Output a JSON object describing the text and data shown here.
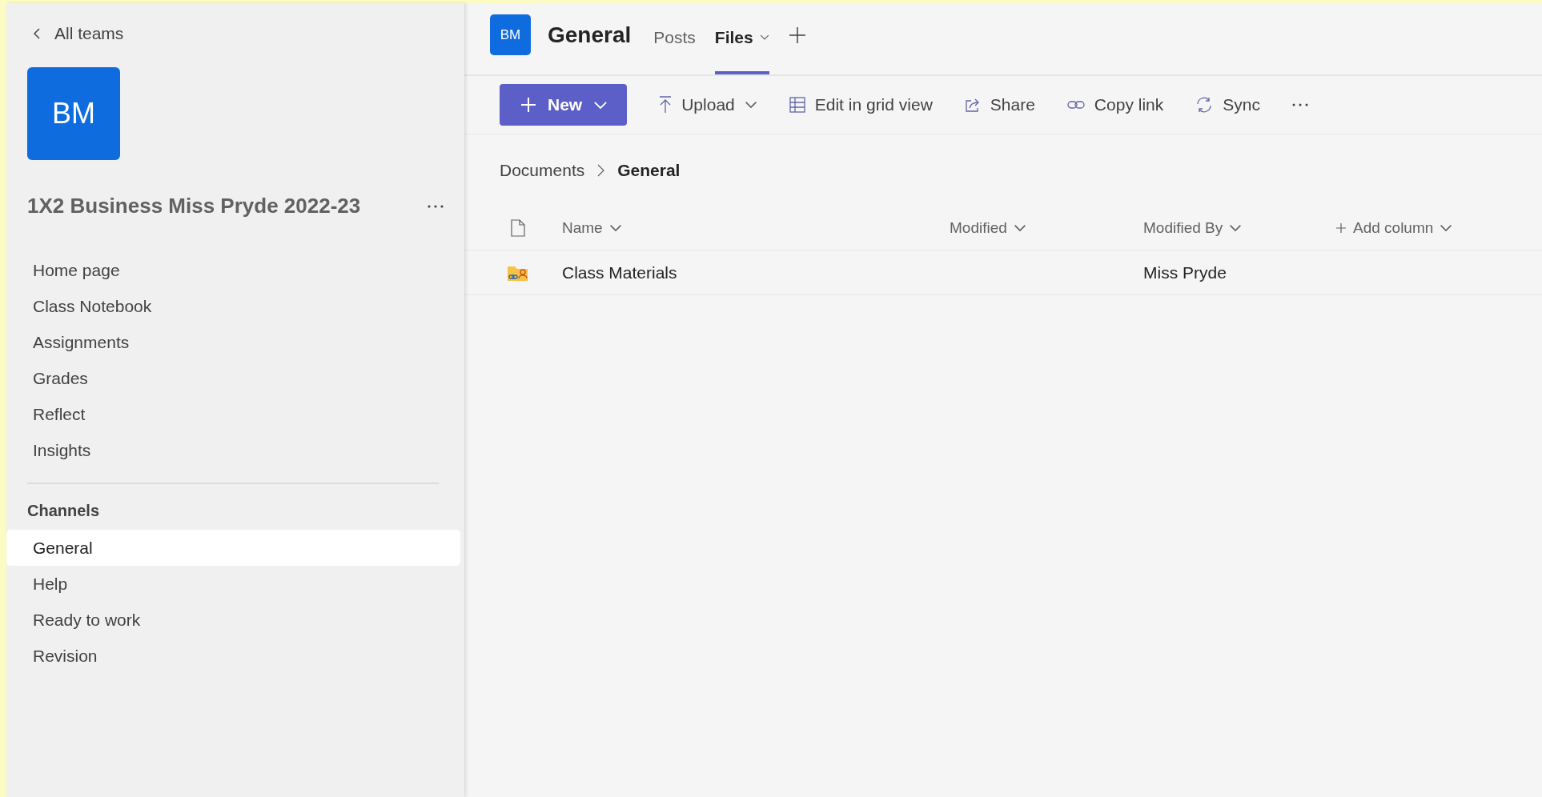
{
  "sidebar": {
    "back_link": "All teams",
    "team_avatar": "BM",
    "team_name": "1X2 Business Miss Pryde 2022-23",
    "nav_items": [
      {
        "label": "Home page"
      },
      {
        "label": "Class Notebook"
      },
      {
        "label": "Assignments"
      },
      {
        "label": "Grades"
      },
      {
        "label": "Reflect"
      },
      {
        "label": "Insights"
      }
    ],
    "channels_heading": "Channels",
    "channels": [
      {
        "label": "General",
        "selected": true
      },
      {
        "label": "Help",
        "selected": false
      },
      {
        "label": "Ready to work",
        "selected": false
      },
      {
        "label": "Revision",
        "selected": false
      }
    ]
  },
  "header": {
    "avatar": "BM",
    "title": "General",
    "tabs": [
      {
        "label": "Posts",
        "selected": false,
        "dropdown": false
      },
      {
        "label": "Files",
        "selected": true,
        "dropdown": true
      }
    ]
  },
  "toolbar": [
    {
      "kind": "new",
      "label": "New",
      "dropdown": true
    },
    {
      "kind": "upload",
      "label": "Upload",
      "dropdown": true
    },
    {
      "kind": "grid",
      "label": "Edit in grid view",
      "dropdown": false
    },
    {
      "kind": "share",
      "label": "Share",
      "dropdown": false
    },
    {
      "kind": "link",
      "label": "Copy link",
      "dropdown": false
    },
    {
      "kind": "sync",
      "label": "Sync",
      "dropdown": false
    },
    {
      "kind": "more"
    }
  ],
  "breadcrumb": [
    {
      "label": "Documents",
      "current": false
    },
    {
      "label": "General",
      "current": true
    }
  ],
  "table": {
    "columns": [
      {
        "kind": "sort",
        "label": "Name"
      },
      {
        "kind": "sort",
        "label": "Modified"
      },
      {
        "kind": "sort",
        "label": "Modified By"
      },
      {
        "kind": "add",
        "label": "Add column"
      }
    ],
    "rows": [
      {
        "name": "Class Materials",
        "modified_by": "Miss Pryde"
      }
    ]
  }
}
